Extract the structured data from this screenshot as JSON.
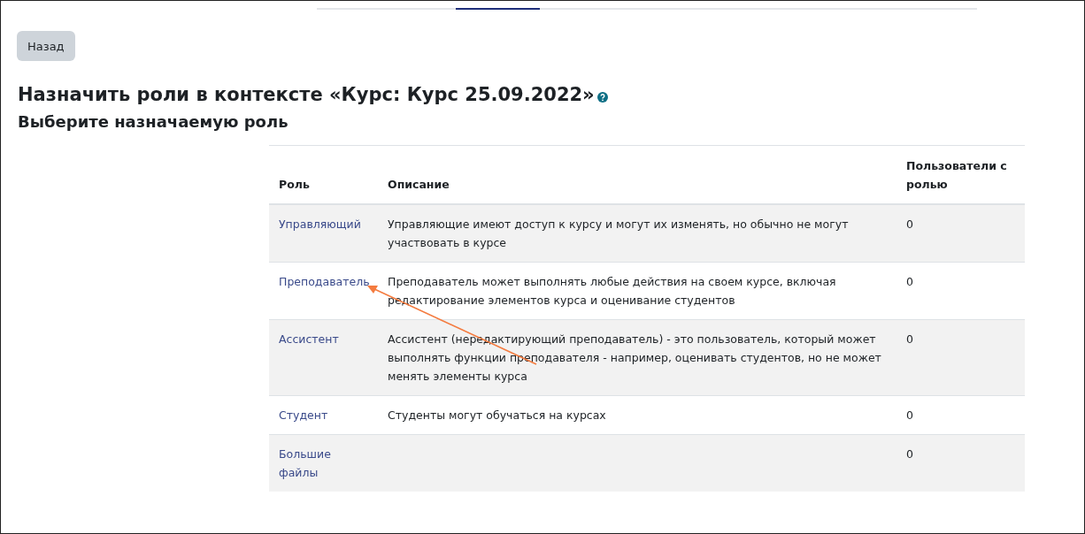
{
  "tabs": [
    {
      "selected": false
    },
    {
      "selected": true
    },
    {
      "selected": false
    }
  ],
  "back_button": "Назад",
  "title": "Назначить роли в контексте «Курс: Курс 25.09.2022»",
  "subtitle": "Выберите назначаемую роль",
  "table": {
    "columns": [
      "Роль",
      "Описание",
      "Пользователи с ролью"
    ],
    "rows": [
      {
        "role": "Управляющий",
        "description": "Управляющие имеют доступ к курсу и могут их изменять, но обычно не могут участвовать в курсе",
        "users": "0"
      },
      {
        "role": "Преподаватель",
        "description": "Преподаватель может выполнять любые действия на своем курсе, включая редактирование элементов курса и оценивание студентов",
        "users": "0"
      },
      {
        "role": "Ассистент",
        "description": "Ассистент (нередактирующий преподаватель) - это пользователь, который может выполнять функции преподавателя - например, оценивать студентов, но не может менять элементы курса",
        "users": "0"
      },
      {
        "role": "Студент",
        "description": "Студенты могут обучаться на курсах",
        "users": "0"
      },
      {
        "role": "Большие файлы",
        "users": "0"
      }
    ]
  }
}
